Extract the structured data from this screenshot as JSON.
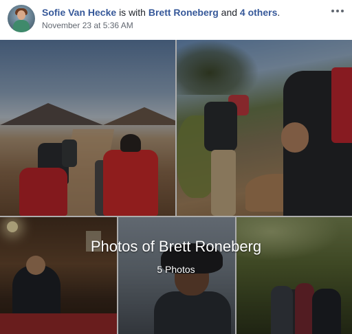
{
  "post": {
    "author": "Sofie Van Hecke",
    "with_text": "is with",
    "tagged_person": "Brett Roneberg",
    "and_text": "and",
    "others_link": "4 others",
    "period": ".",
    "timestamp": "November 23 at 5:36 AM",
    "more_icon": "more-options-icon"
  },
  "album": {
    "title": "Photos of Brett Roneberg",
    "count": "5 Photos"
  },
  "colors": {
    "link": "#365899",
    "secondary_text": "#616770"
  }
}
